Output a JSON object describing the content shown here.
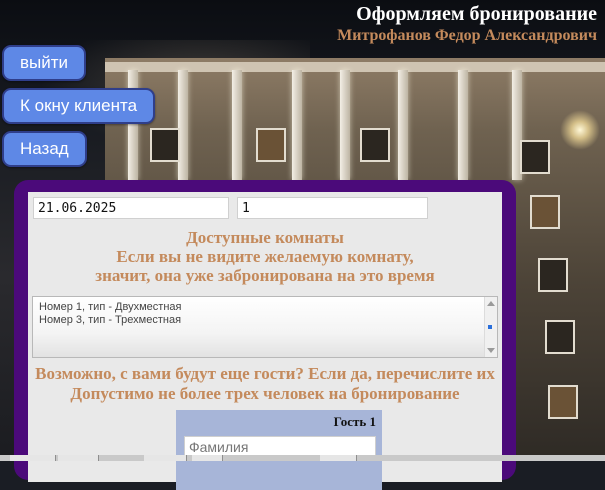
{
  "header": {
    "title": "Оформляем бронирование",
    "user_name": "Митрофанов Федор Александрович"
  },
  "nav": {
    "logout_label": "выйти",
    "client_window_label": "К окну клиента",
    "back_label": "Назад"
  },
  "form": {
    "date_value": "21.06.2025",
    "nights_value": "1",
    "available_heading_line1": "Доступные комнаты",
    "available_heading_line2": "Если вы не видите желаемую комнату,",
    "available_heading_line3": "значит, она уже забронирована на это время",
    "rooms": [
      "Номер 1, тип - Двухместная",
      "Номер 3, тип - Трехместная"
    ],
    "guests_heading_line1": "Возможно, с вами будут еще гости? Если да, перечислите их",
    "guests_heading_line2": "Допустимо не более трех человек на бронирование",
    "guest_block": {
      "title": "Гость 1",
      "surname_placeholder": "Фамилия"
    }
  },
  "colors": {
    "accent_text": "#c48a5c",
    "panel_border": "#4b0a7a",
    "button_bg": "#5e88e6",
    "guest_block_bg": "#a7b5d8"
  },
  "icons": {
    "listbox_scroll_up": "chevron-up-icon",
    "listbox_scroll_down": "chevron-down-icon"
  }
}
